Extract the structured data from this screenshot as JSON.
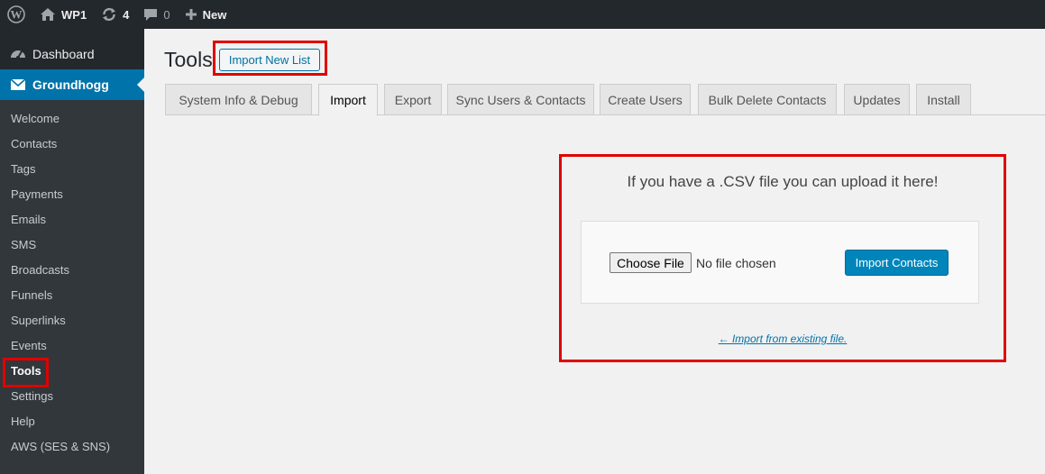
{
  "adminbar": {
    "site_name": "WP1",
    "updates_count": "4",
    "comments_count": "0",
    "new_label": "New"
  },
  "sidebar": {
    "dashboard": "Dashboard",
    "plugin": "Groundhogg",
    "items": [
      "Welcome",
      "Contacts",
      "Tags",
      "Payments",
      "Emails",
      "SMS",
      "Broadcasts",
      "Funnels",
      "Superlinks",
      "Events",
      "Tools",
      "Settings",
      "Help",
      "AWS (SES & SNS)"
    ],
    "current_item": "Tools"
  },
  "page": {
    "title": "Tools",
    "title_button": "Import New List"
  },
  "tabs": [
    "System Info & Debug",
    "Import",
    "Export",
    "Sync Users & Contacts",
    "Create Users",
    "Bulk Delete Contacts",
    "Updates",
    "Install"
  ],
  "active_tab": "Import",
  "import": {
    "prompt": "If you have a .CSV file you can upload it here!",
    "choose_file": "Choose File",
    "no_file": "No file chosen",
    "submit": "Import Contacts",
    "existing_link": "← Import from existing file."
  },
  "colors": {
    "admin_bg": "#23282d",
    "submenu_bg": "#32373c",
    "accent": "#0073aa",
    "primary_button": "#0085ba",
    "highlight": "#e00000"
  }
}
